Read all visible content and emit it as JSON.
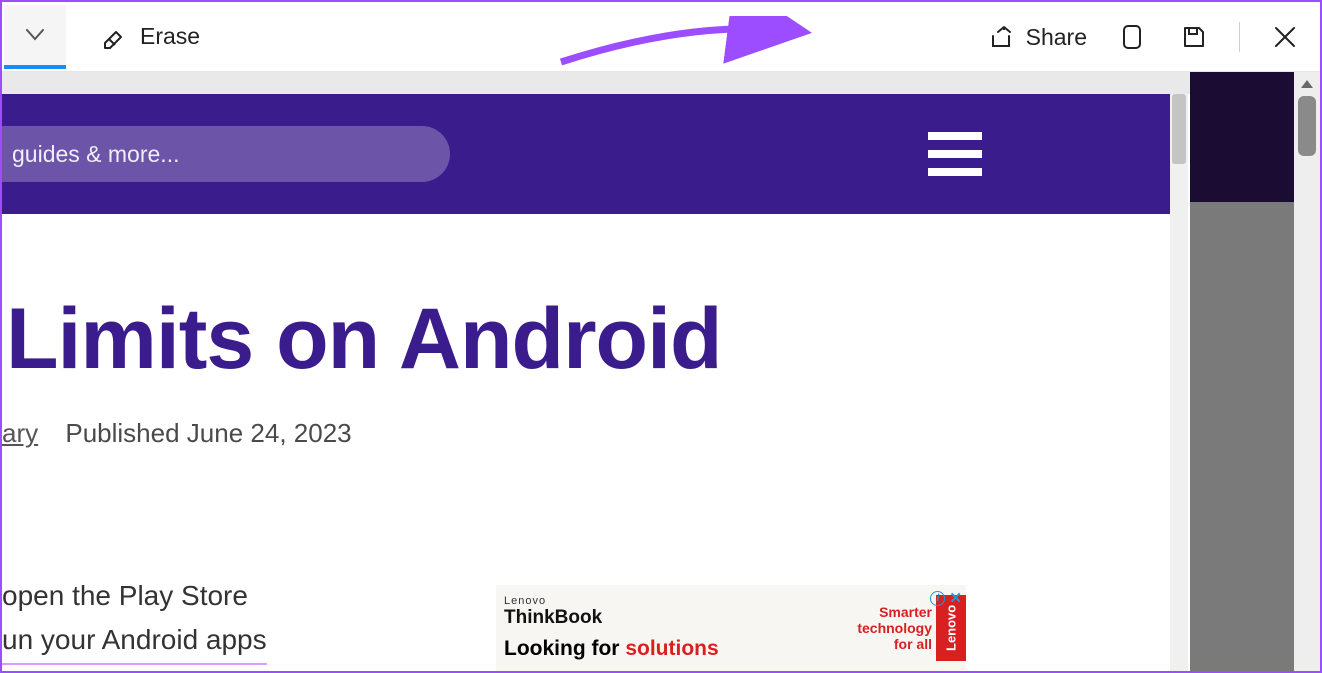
{
  "toolbar": {
    "erase_label": "Erase",
    "share_label": "Share"
  },
  "site": {
    "search_placeholder": "guides & more..."
  },
  "article": {
    "title_fragment": "Limits on Android",
    "author_fragment": "ary",
    "published_label": "Published",
    "published_date": "June 24, 2023",
    "body_line1": "open the Play Store",
    "body_line2": "un your Android apps"
  },
  "ad": {
    "brand_small": "Lenovo",
    "brand_big": "ThinkBook",
    "line_prefix": "Looking for ",
    "line_accent": "solutions",
    "slogan_l1": "Smarter",
    "slogan_l2": "technology",
    "slogan_l3": "for all",
    "tab": "Lenovo",
    "info": "i",
    "close": "✕"
  }
}
